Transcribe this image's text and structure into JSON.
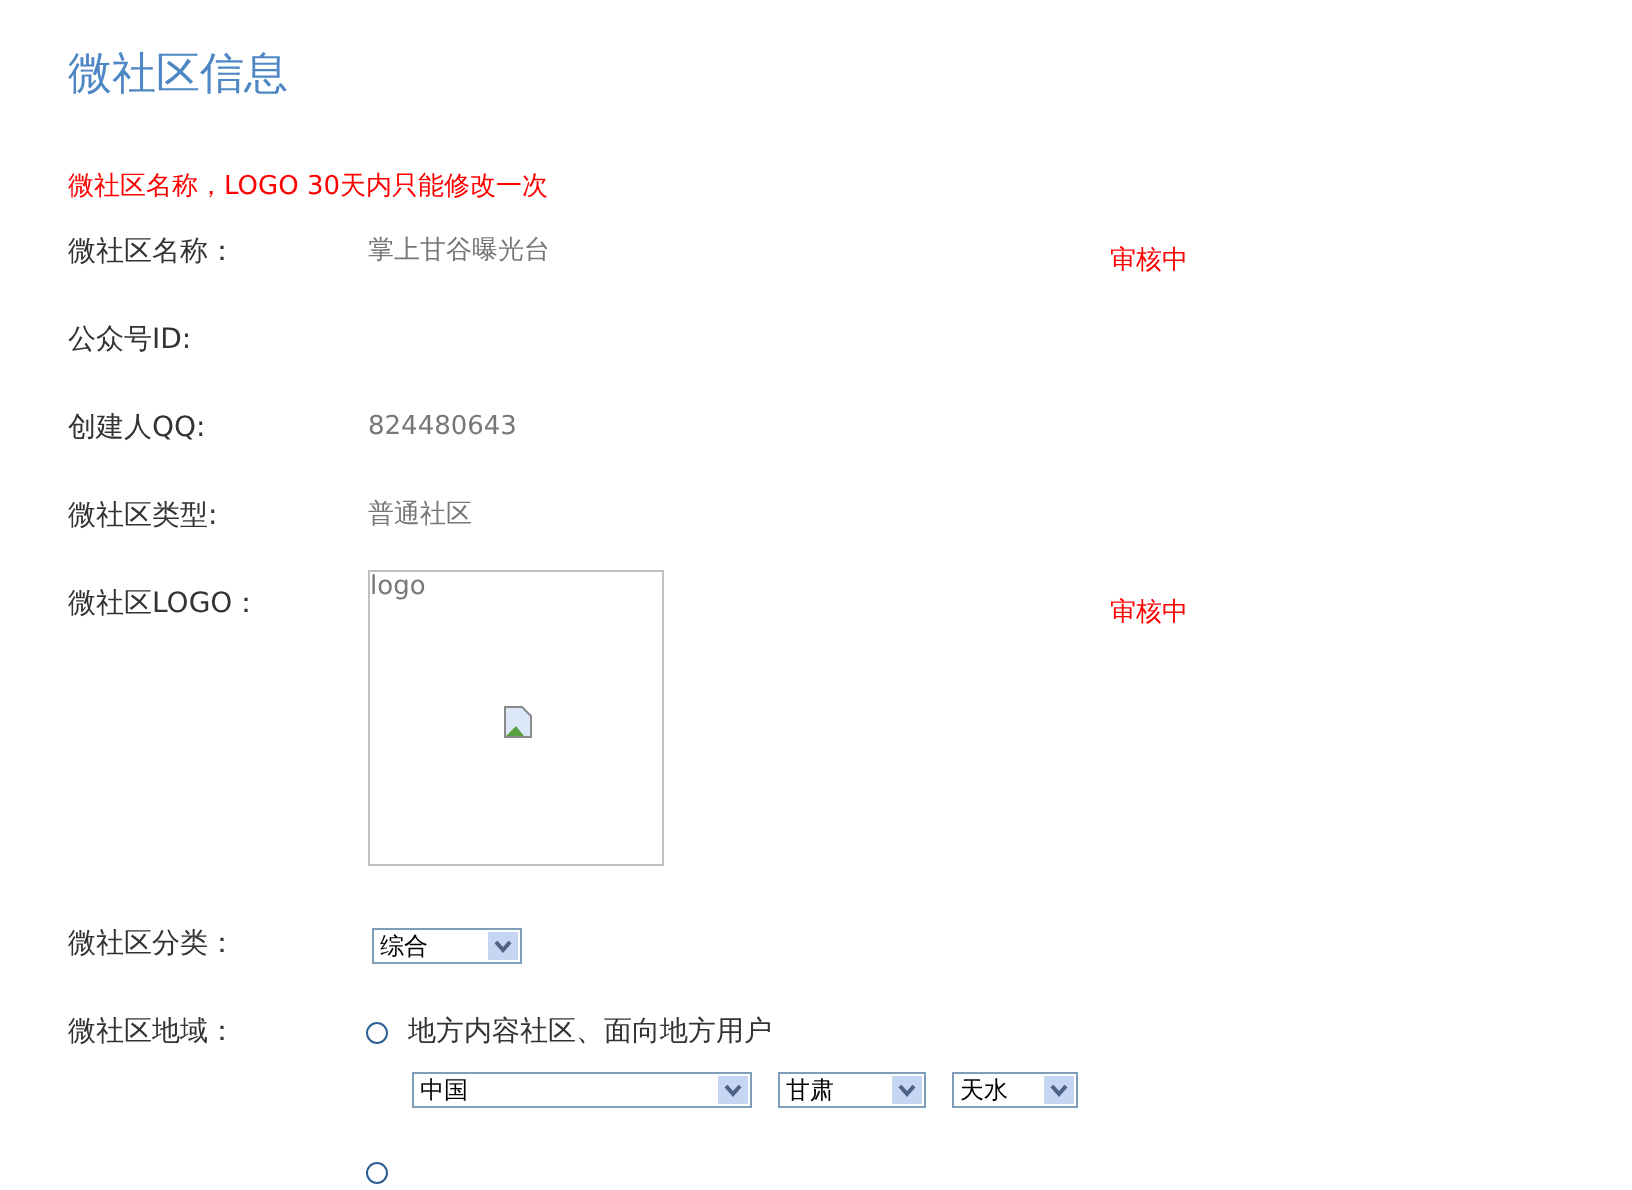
{
  "title": "微社区信息",
  "notice": "微社区名称，LOGO 30天内只能修改一次",
  "fields": [
    {
      "kind": "text",
      "label": "微社区名称：",
      "value": "掌上甘谷曝光台",
      "status": "审核中"
    },
    {
      "kind": "text",
      "label": "公众号ID:"
    },
    {
      "kind": "text",
      "label": "创建人QQ:",
      "value": "824480643"
    },
    {
      "kind": "text",
      "label": "微社区类型:",
      "value": "普通社区"
    },
    {
      "kind": "logo",
      "label": "微社区LOGO：",
      "alt": "logo",
      "status": "审核中"
    },
    {
      "kind": "select",
      "label": "微社区分类：",
      "value": "综合"
    },
    {
      "kind": "region",
      "label": "微社区地域：",
      "options": [
        {
          "label": "地方内容社区、面向地方用户",
          "selected": false,
          "selects": [
            "中国",
            "甘肃",
            "天水"
          ]
        },
        {
          "selected": false
        }
      ]
    }
  ]
}
